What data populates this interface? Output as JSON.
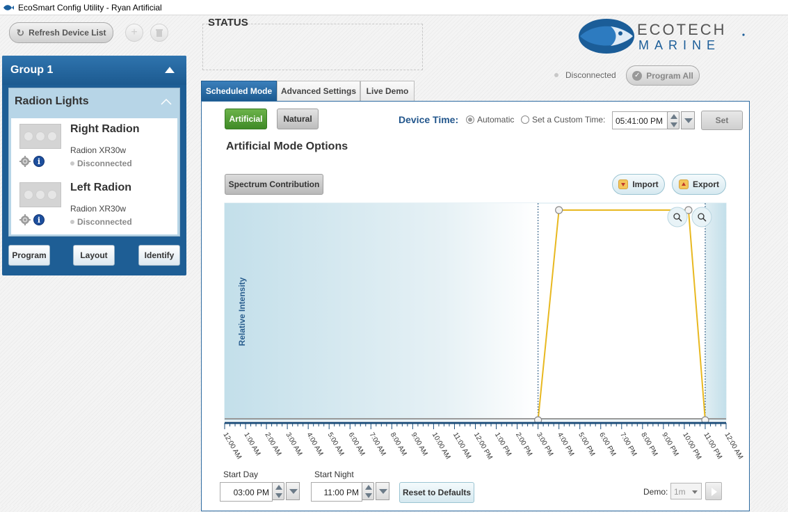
{
  "window": {
    "title": "EcoSmart Config Utility - Ryan Artificial"
  },
  "toolbar": {
    "refresh_label": "Refresh Device List"
  },
  "group": {
    "title": "Group 1",
    "section_title": "Radion Lights",
    "devices": [
      {
        "name": "Right Radion",
        "model": "Radion XR30w",
        "status": "Disconnected"
      },
      {
        "name": "Left Radion",
        "model": "Radion XR30w",
        "status": "Disconnected"
      }
    ],
    "buttons": {
      "program": "Program",
      "layout": "Layout",
      "identify": "Identify"
    }
  },
  "status": {
    "label": "STATUS"
  },
  "logo": {
    "line1": "ECOTECH",
    "line2": "MARINE"
  },
  "connection": {
    "status": "Disconnected",
    "program_all": "Program All"
  },
  "tabs": [
    {
      "label": "Scheduled Mode",
      "active": true
    },
    {
      "label": "Advanced Settings",
      "active": false
    },
    {
      "label": "Live Demo",
      "active": false
    }
  ],
  "mode": {
    "artificial_label": "Artificial",
    "natural_label": "Natural",
    "selected": "Artificial"
  },
  "device_time": {
    "label": "Device Time:",
    "automatic_label": "Automatic",
    "custom_label": "Set a Custom Time:",
    "selected": "Automatic",
    "time_value": "05:41:00 PM",
    "set_label": "Set"
  },
  "options": {
    "title": "Artificial Mode Options",
    "spectrum_label": "Spectrum Contribution",
    "import_label": "Import",
    "export_label": "Export"
  },
  "chart_data": {
    "type": "line",
    "ylabel": "Relative Intensity",
    "x_ticks": [
      "12:00 AM",
      "1:00 AM",
      "2:00 AM",
      "3:00 AM",
      "4:00 AM",
      "5:00 AM",
      "6:00 AM",
      "7:00 AM",
      "8:00 AM",
      "9:00 AM",
      "10:00 AM",
      "11:00 AM",
      "12:00 PM",
      "1:00 PM",
      "2:00 PM",
      "3:00 PM",
      "4:00 PM",
      "5:00 PM",
      "6:00 PM",
      "7:00 PM",
      "8:00 PM",
      "9:00 PM",
      "10:00 PM",
      "11:00 PM",
      "12:00 AM"
    ],
    "xlim_hours": [
      0,
      24
    ],
    "ylim": [
      0,
      100
    ],
    "series": [
      {
        "color": "#e8b820",
        "points": [
          [
            15.0,
            0
          ],
          [
            16.0,
            100
          ],
          [
            22.2,
            100
          ],
          [
            23.0,
            0
          ]
        ]
      }
    ],
    "day_start_hour": 15,
    "night_start_hour": 23,
    "colors": {
      "night_shade": "#c9e3ec",
      "curve": "#e8b820",
      "axis": "#1d4e7a"
    }
  },
  "schedule": {
    "start_day_label": "Start Day",
    "start_day_value": "03:00 PM",
    "start_night_label": "Start Night",
    "start_night_value": "11:00 PM",
    "reset_label": "Reset to Defaults"
  },
  "demo": {
    "label": "Demo:",
    "value": "1m"
  }
}
